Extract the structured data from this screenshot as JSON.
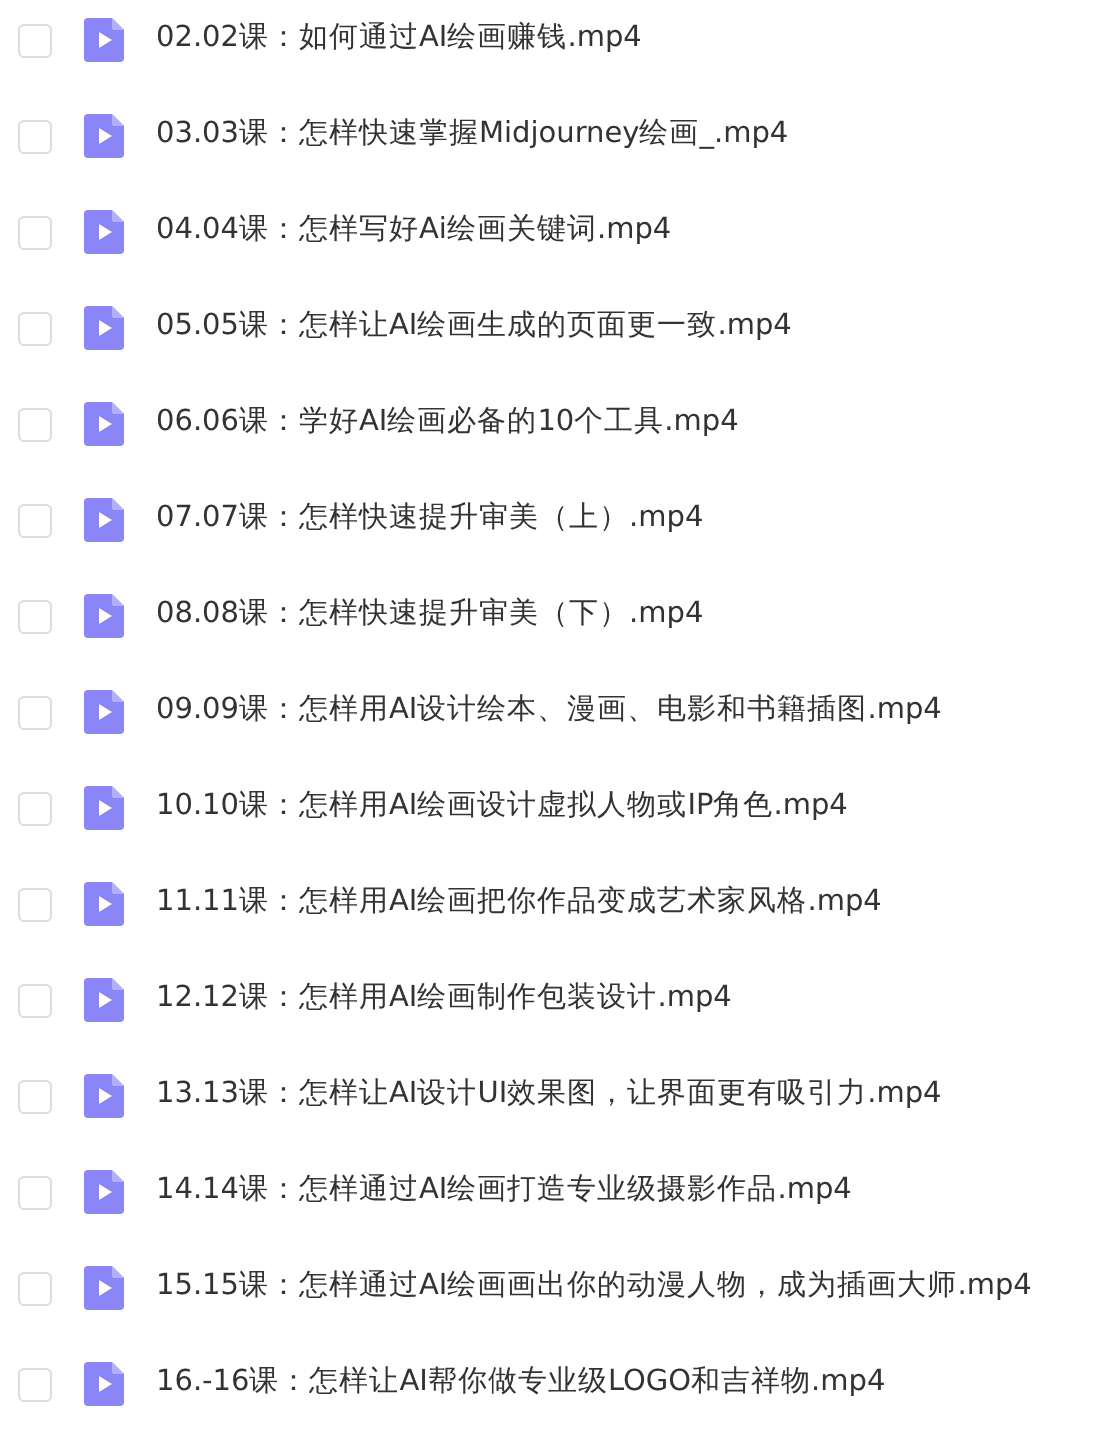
{
  "files": [
    {
      "name": "02.02课：如何通过AI绘画赚钱.mp4",
      "checked": false
    },
    {
      "name": "03.03课：怎样快速掌握Midjourney绘画_.mp4",
      "checked": false
    },
    {
      "name": "04.04课：怎样写好Ai绘画关键词.mp4",
      "checked": false
    },
    {
      "name": "05.05课：怎样让AI绘画生成的页面更一致.mp4",
      "checked": false
    },
    {
      "name": "06.06课：学好AI绘画必备的10个工具.mp4",
      "checked": false
    },
    {
      "name": "07.07课：怎样快速提升审美（上）.mp4",
      "checked": false
    },
    {
      "name": "08.08课：怎样快速提升审美（下）.mp4",
      "checked": false
    },
    {
      "name": "09.09课：怎样用AI设计绘本、漫画、电影和书籍插图.mp4",
      "checked": false
    },
    {
      "name": "10.10课：怎样用AI绘画设计虚拟人物或IP角色.mp4",
      "checked": false
    },
    {
      "name": "11.11课：怎样用AI绘画把你作品变成艺术家风格.mp4",
      "checked": false
    },
    {
      "name": "12.12课：怎样用AI绘画制作包装设计.mp4",
      "checked": false
    },
    {
      "name": "13.13课：怎样让AI设计UI效果图，让界面更有吸引力.mp4",
      "checked": false
    },
    {
      "name": "14.14课：怎样通过AI绘画打造专业级摄影作品.mp4",
      "checked": false
    },
    {
      "name": "15.15课：怎样通过AI绘画画出你的动漫人物，成为插画大师.mp4",
      "checked": false
    },
    {
      "name": "16.-16课：怎样让AI帮你做专业级LOGO和吉祥物.mp4",
      "checked": false
    }
  ]
}
